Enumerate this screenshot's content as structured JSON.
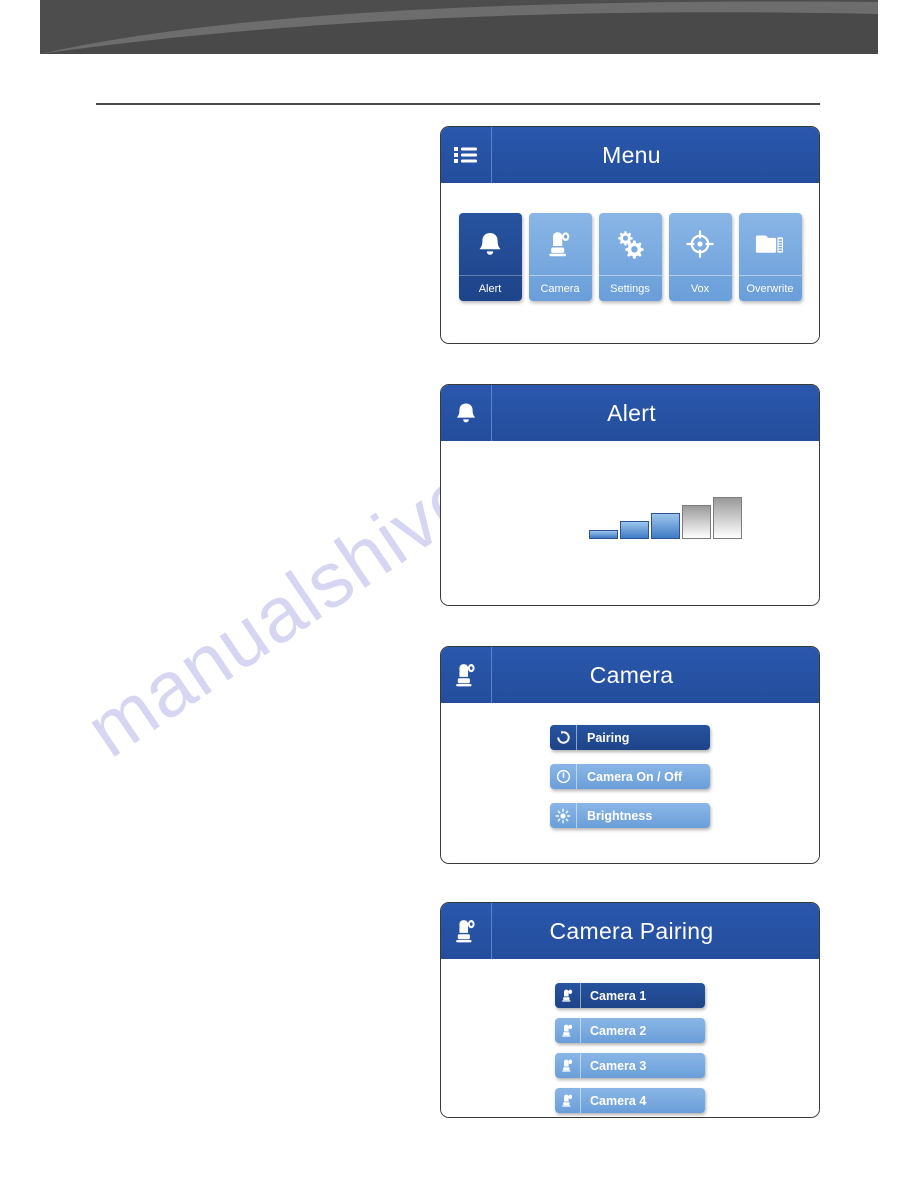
{
  "page": {
    "watermark_text": "manualshive.com",
    "banner_color": "#4a4a4a",
    "accent_blue": "#2753a8",
    "light_blue": "#7aaae0"
  },
  "panels": [
    {
      "id": "menu",
      "title": "Menu",
      "title_icon": "hamburger-menu-icon",
      "tiles": [
        {
          "label": "Alert",
          "icon": "bell-icon",
          "selected": true
        },
        {
          "label": "Camera",
          "icon": "camera-icon",
          "selected": false
        },
        {
          "label": "Settings",
          "icon": "gears-icon",
          "selected": false
        },
        {
          "label": "Vox",
          "icon": "crosshair-icon",
          "selected": false
        },
        {
          "label": "Overwrite",
          "icon": "folder-sd-icon",
          "selected": false
        }
      ]
    },
    {
      "id": "alert",
      "title": "Alert",
      "title_icon": "bell-icon",
      "volume": {
        "segments": 5,
        "filled": 3
      }
    },
    {
      "id": "camera",
      "title": "Camera",
      "title_icon": "camera-icon",
      "buttons": [
        {
          "label": "Pairing",
          "icon": "refresh-circle-icon",
          "selected": true
        },
        {
          "label": "Camera On / Off",
          "icon": "power-circle-icon",
          "selected": false
        },
        {
          "label": "Brightness",
          "icon": "sun-icon",
          "selected": false
        }
      ]
    },
    {
      "id": "pairing",
      "title": "Camera Pairing",
      "title_icon": "camera-icon",
      "cameras": [
        {
          "label": "Camera 1",
          "icon": "camera-icon",
          "selected": true
        },
        {
          "label": "Camera 2",
          "icon": "camera-icon",
          "selected": false
        },
        {
          "label": "Camera 3",
          "icon": "camera-icon",
          "selected": false
        },
        {
          "label": "Camera 4",
          "icon": "camera-icon",
          "selected": false
        }
      ]
    }
  ]
}
